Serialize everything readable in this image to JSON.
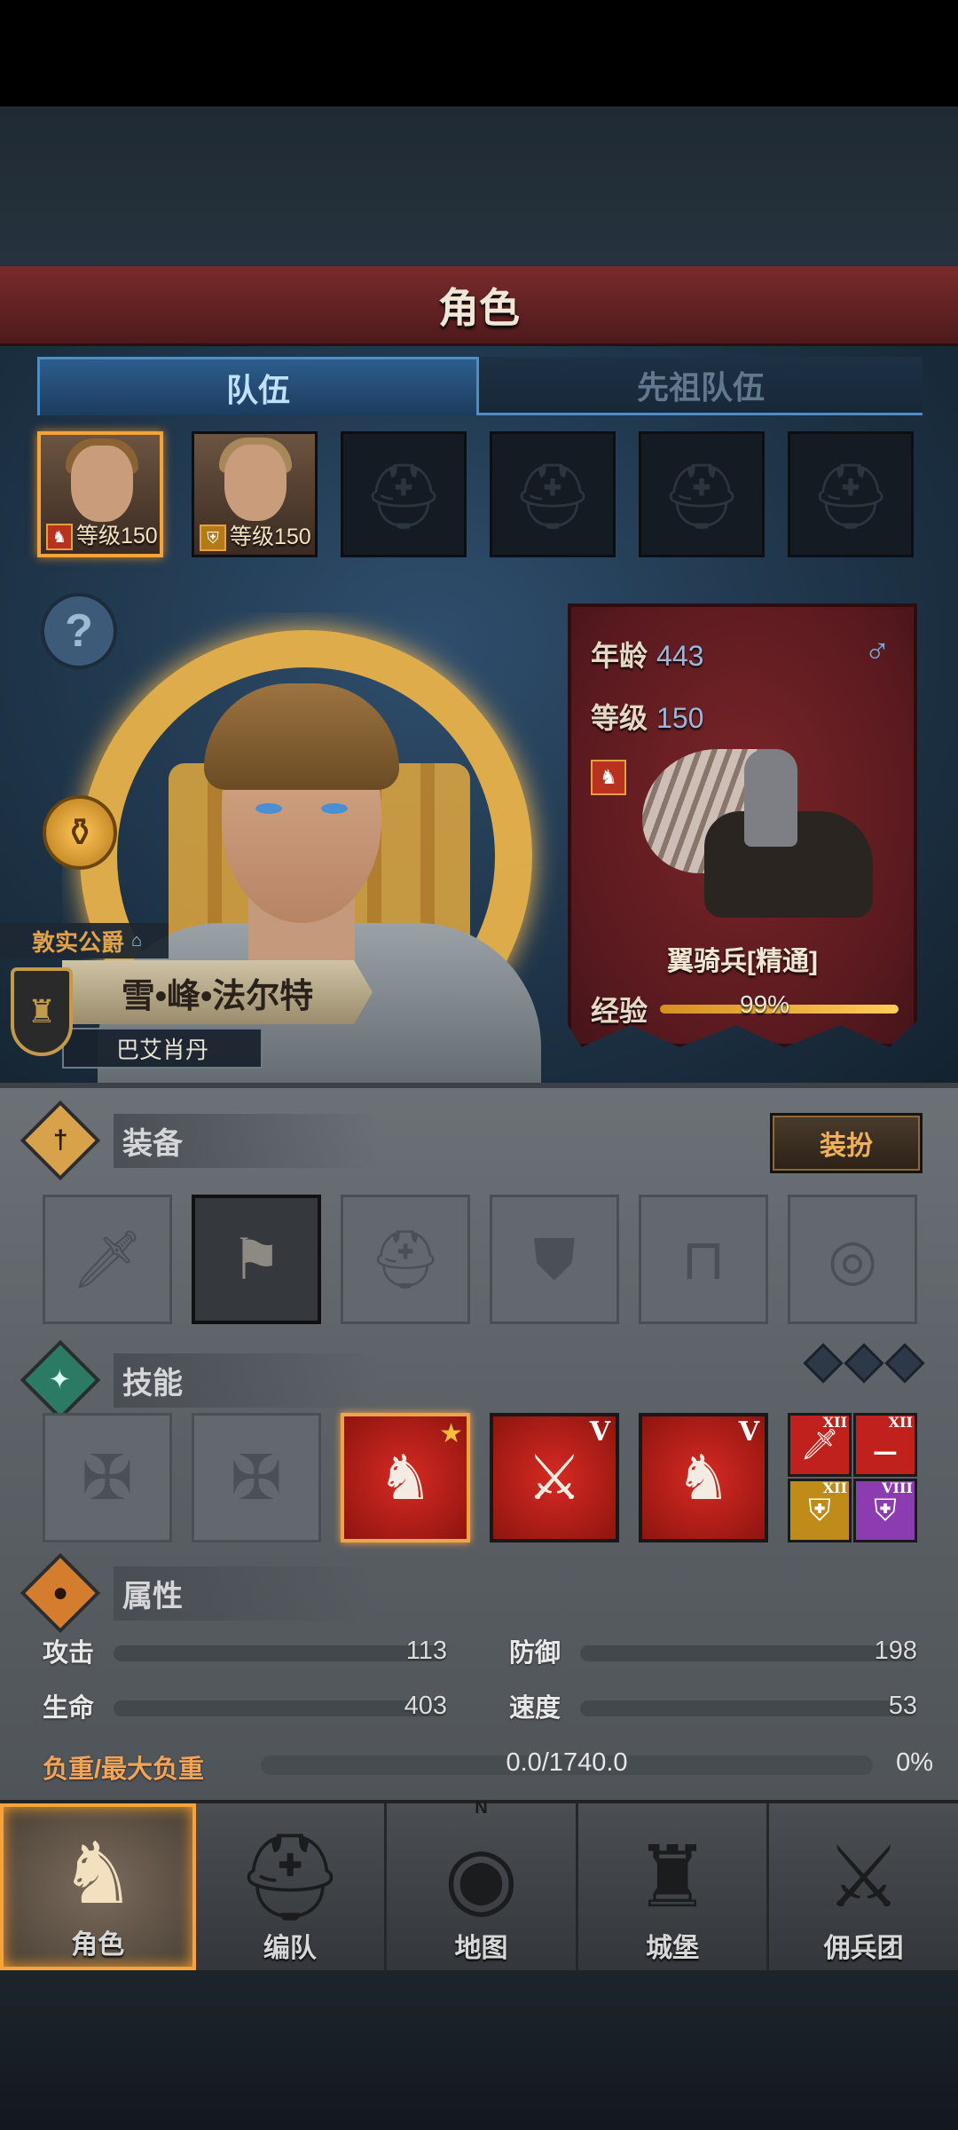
{
  "header": {
    "title": "角色"
  },
  "tabs": [
    {
      "label": "队伍",
      "active": true
    },
    {
      "label": "先祖队伍",
      "active": false
    }
  ],
  "team_slots": [
    {
      "filled": true,
      "level_text": "等级150",
      "selected": true
    },
    {
      "filled": true,
      "level_text": "等级150",
      "selected": false
    },
    {
      "filled": false
    },
    {
      "filled": false
    },
    {
      "filled": false
    },
    {
      "filled": false
    }
  ],
  "hero": {
    "title": "敦实公爵",
    "name": "雪•峰•法尔特",
    "origin": "巴艾肖丹"
  },
  "info": {
    "age_label": "年龄",
    "age_value": "443",
    "gender_icon": "male-icon",
    "level_label": "等级",
    "level_value": "150",
    "class_name": "翼骑兵[精通]",
    "exp_label": "经验",
    "exp_value": "99%",
    "exp_fraction": 0.99
  },
  "equipment": {
    "title": "装备",
    "dress_button": "装扮",
    "slots": [
      "sword-icon",
      "banner-icon",
      "helmet-icon",
      "armor-icon",
      "boots-icon",
      "ring-icon"
    ]
  },
  "skills": {
    "title": "技能",
    "large": [
      {
        "icon": "empty-skill-icon"
      },
      {
        "icon": "empty-skill-icon"
      },
      {
        "icon": "horse-banner-icon",
        "star": true
      },
      {
        "icon": "dumbbell-sword-icon",
        "rank": "V"
      },
      {
        "icon": "dumbbell-horse-icon",
        "rank": "V"
      }
    ],
    "small": [
      {
        "icon": "sword-icon",
        "rank": "XII"
      },
      {
        "icon": "dumbbell-icon",
        "rank": "XII"
      },
      {
        "icon": "shield-icon",
        "rank": "XII"
      },
      {
        "icon": "shield-icon",
        "rank": "VIII"
      }
    ]
  },
  "attributes": {
    "title": "属性",
    "attack_label": "攻击",
    "attack_value": "113",
    "defense_label": "防御",
    "defense_value": "198",
    "hp_label": "生命",
    "hp_value": "403",
    "speed_label": "速度",
    "speed_value": "53",
    "load_label": "负重/最大负重",
    "load_value": "0.0/1740.0",
    "load_pct": "0%",
    "load_fraction": 0.0
  },
  "nav": [
    {
      "label": "角色",
      "icon": "knight-icon",
      "active": true
    },
    {
      "label": "编队",
      "icon": "helmet-icon",
      "active": false
    },
    {
      "label": "地图",
      "icon": "compass-icon",
      "active": false,
      "compass_letter": "N"
    },
    {
      "label": "城堡",
      "icon": "castle-icon",
      "active": false
    },
    {
      "label": "佣兵团",
      "icon": "mercenary-icon",
      "active": false
    }
  ]
}
